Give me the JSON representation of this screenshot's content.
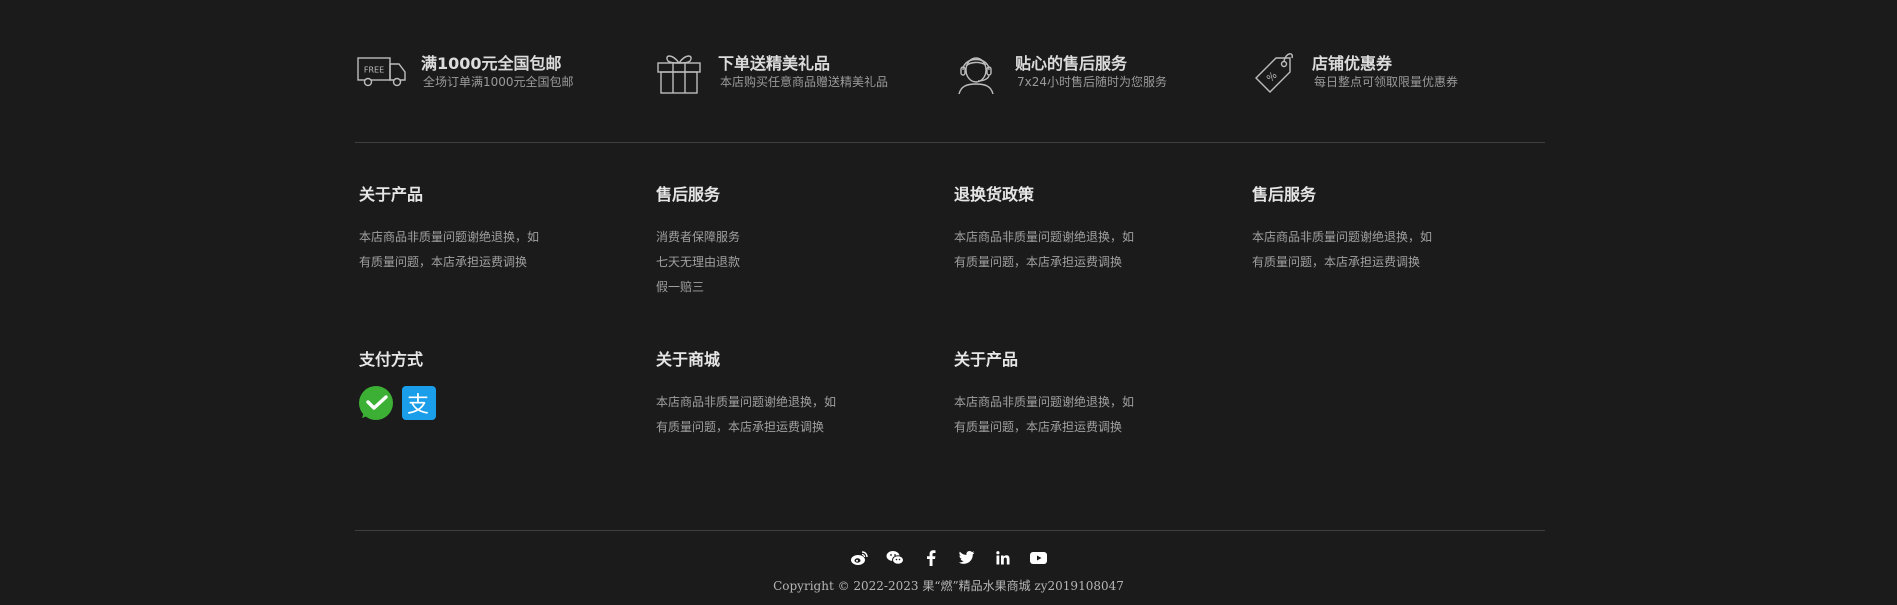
{
  "features": [
    {
      "icon": "free-shipping-truck-icon",
      "badge": "FREE",
      "title": "满1000元全国包邮",
      "desc": "全场订单满1000元全国包邮"
    },
    {
      "icon": "gift-box-icon",
      "title": "下单送精美礼品",
      "desc": "本店购买任意商品赠送精美礼品"
    },
    {
      "icon": "customer-service-icon",
      "title": "贴心的售后服务",
      "desc": "7x24小时售后随时为您服务"
    },
    {
      "icon": "coupon-tag-icon",
      "title": "店铺优惠券",
      "desc": "每日整点可领取限量优惠券"
    }
  ],
  "columns": {
    "about_product": {
      "title": "关于产品",
      "text": "本店商品非质量问题谢绝退换，如有质量问题，本店承担运费调换"
    },
    "after_sales": {
      "title": "售后服务",
      "items": [
        "消费者保障服务",
        "七天无理由退款",
        "假一赔三"
      ]
    },
    "return_policy": {
      "title": "退换货政策",
      "text": "本店商品非质量问题谢绝退换，如有质量问题，本店承担运费调换"
    },
    "after_sales_2": {
      "title": "售后服务",
      "text": "本店商品非质量问题谢绝退换，如有质量问题，本店承担运费调换"
    },
    "payment": {
      "title": "支付方式",
      "methods": [
        "wechat-pay-icon",
        "alipay-icon"
      ]
    },
    "about_mall": {
      "title": "关于商城",
      "text": "本店商品非质量问题谢绝退换，如有质量问题，本店承担运费调换"
    },
    "about_product_2": {
      "title": "关于产品",
      "text": "本店商品非质量问题谢绝退换，如有质量问题，本店承担运费调换"
    }
  },
  "social": [
    "weibo-icon",
    "wechat-icon",
    "facebook-icon",
    "twitter-icon",
    "linkedin-icon",
    "youtube-icon"
  ],
  "copyright": "Copyright © 2022-2023 果“燃”精品水果商城 zy2019108047",
  "colors": {
    "background": "#1b1b1b",
    "divider": "#3f3f3f",
    "wechat_green": "#3cb034",
    "alipay_blue": "#1a9eea"
  }
}
